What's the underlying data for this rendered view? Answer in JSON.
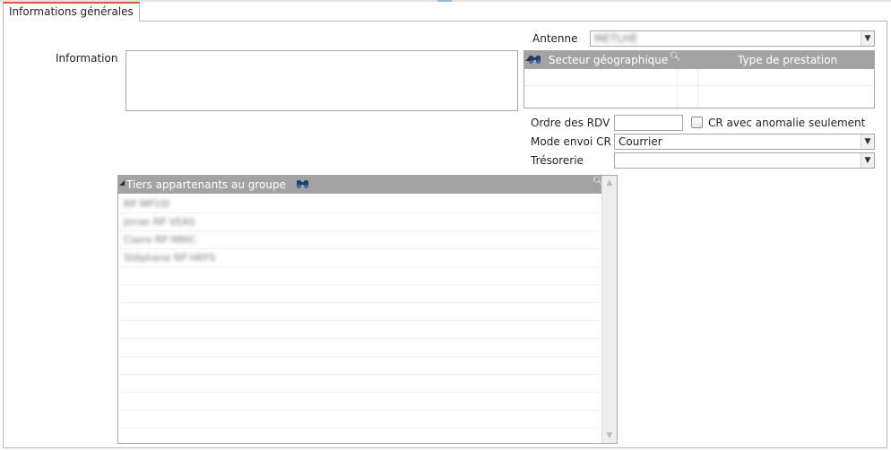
{
  "tabs": [
    {
      "label": "Informations générales",
      "active": true
    }
  ],
  "colors": {
    "tab_accent": "#e0582d",
    "grid_header_bg": "#a3a3a3"
  },
  "form": {
    "information_label": "Information",
    "information_value": "",
    "antenne_label": "Antenne",
    "antenne_value": "METLHE",
    "ordre_rdv_label": "Ordre des RDV",
    "ordre_rdv_value": "",
    "cr_anomalie_label": "CR avec anomalie seulement",
    "cr_anomalie_checked": false,
    "mode_envoi_label": "Mode envoi CR",
    "mode_envoi_value": "Courrier",
    "tresorerie_label": "Trésorerie",
    "tresorerie_value": ""
  },
  "secteur_grid": {
    "columns": [
      "Secteur géographique",
      "Type de prestation"
    ],
    "rows": []
  },
  "tiers_list": {
    "title": "Tiers appartenants au groupe",
    "items": [
      "RP MP10I",
      "Jonas RP VEAS",
      "Claire RP MRIC",
      "Stéphane RP HKFS"
    ]
  }
}
